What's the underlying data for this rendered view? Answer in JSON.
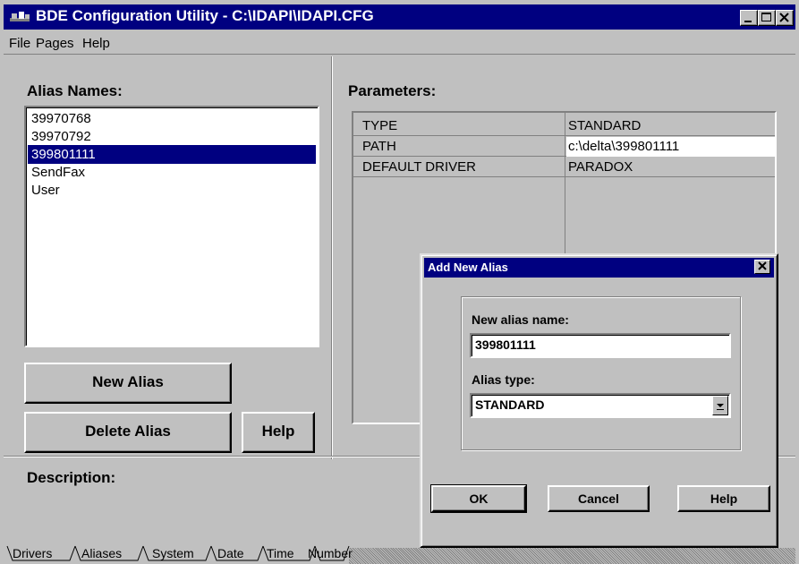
{
  "window": {
    "title": "BDE Configuration Utility - C:\\IDAPI\\IDAPI.CFG",
    "icon": "bde-app-icon"
  },
  "menu": {
    "file": "File",
    "pages": "Pages",
    "help": "Help"
  },
  "aliases": {
    "label": "Alias Names:",
    "items": [
      "39970768",
      "39970792",
      "399801111",
      "SendFax",
      "User"
    ],
    "selected": "399801111",
    "new_button": "New Alias",
    "delete_button": "Delete Alias",
    "help_button": "Help"
  },
  "parameters": {
    "label": "Parameters:",
    "rows": [
      {
        "name": "TYPE",
        "value": "STANDARD"
      },
      {
        "name": "PATH",
        "value": "c:\\delta\\399801111"
      },
      {
        "name": "DEFAULT DRIVER",
        "value": "PARADOX"
      }
    ]
  },
  "description": {
    "label": "Description:"
  },
  "tabs": [
    "Drivers",
    "Aliases",
    "System",
    "Date",
    "Time",
    "Number"
  ],
  "active_tab": "Aliases",
  "dialog": {
    "title": "Add New Alias",
    "name_label": "New alias name:",
    "name_value": "399801111",
    "type_label": "Alias type:",
    "type_value": "STANDARD",
    "ok": "OK",
    "cancel": "Cancel",
    "help": "Help"
  },
  "colors": {
    "face": "#c0c0c0",
    "titlebar": "#000080",
    "selection": "#000080"
  }
}
